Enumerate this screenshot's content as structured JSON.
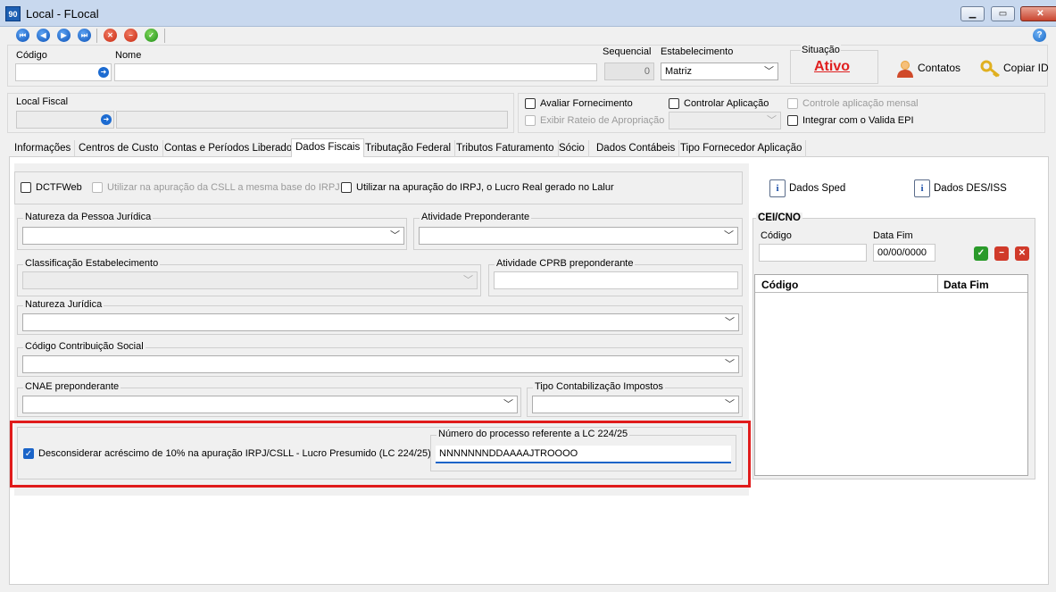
{
  "window": {
    "app_icon": "90",
    "title": "Local - FLocal",
    "minimize": "▁",
    "maximize": "▭",
    "close": "✕"
  },
  "toolbar": {
    "first": "⏮",
    "prev": "◀",
    "next": "▶",
    "last": "⏭",
    "cancel": "✕",
    "delete": "−",
    "confirm": "✓",
    "help": "?"
  },
  "header": {
    "codigo_label": "Código",
    "codigo_value": "",
    "nome_label": "Nome",
    "nome_value": "",
    "sequencial_label": "Sequencial",
    "sequencial_value": "0",
    "estabelecimento_label": "Estabelecimento",
    "estabelecimento_value": "Matriz",
    "situacao_label": "Situação",
    "situacao_value": "Ativo",
    "contatos_label": "Contatos",
    "copiar_id_label": "Copiar ID"
  },
  "fiscal": {
    "local_fiscal_label": "Local Fiscal",
    "local_fiscal_code": "",
    "local_fiscal_name": "",
    "avaliar_fornecimento": "Avaliar Fornecimento",
    "controlar_aplicacao": "Controlar Aplicação",
    "controle_aplicacao_mensal": "Controle aplicação mensal",
    "exibir_rateio": "Exibir Rateio de Apropriação",
    "integrar_valida_epi": "Integrar com o Valida EPI"
  },
  "tabs": [
    {
      "label": "Informações"
    },
    {
      "label": "Centros de Custo"
    },
    {
      "label": "Contas e Períodos Liberados"
    },
    {
      "label": "Dados Fiscais"
    },
    {
      "label": "Tributação Federal"
    },
    {
      "label": "Tributos Faturamento"
    },
    {
      "label": "Sócio"
    },
    {
      "label": "Dados Contábeis"
    },
    {
      "label": "Tipo Fornecedor Aplicação"
    }
  ],
  "dados_fiscais": {
    "dctfweb": "DCTFWeb",
    "utilizar_csll": "Utilizar na apuração da CSLL a mesma base do IRPJ",
    "utilizar_irpj": "Utilizar na apuração do IRPJ, o Lucro Real gerado no Lalur",
    "dados_sped": "Dados Sped",
    "dados_des_iss": "Dados DES/ISS",
    "natureza_pj_label": "Natureza da Pessoa Jurídica",
    "natureza_pj_value": "",
    "atividade_preponderante_label": "Atividade Preponderante",
    "atividade_preponderante_value": "",
    "classificacao_label": "Classificação Estabelecimento",
    "classificacao_value": "",
    "atividade_cprb_label": "Atividade CPRB preponderante",
    "atividade_cprb_value": "",
    "natureza_juridica_label": "Natureza Jurídica",
    "natureza_juridica_value": "",
    "codigo_contrib_label": "Código Contribuição Social",
    "codigo_contrib_value": "",
    "cnae_label": "CNAE preponderante",
    "cnae_value": "",
    "tipo_contab_label": "Tipo Contabilização Impostos",
    "tipo_contab_value": "",
    "desconsiderar_label": "Desconsiderar acréscimo de 10% na apuração IRPJ/CSLL - Lucro Presumido (LC 224/25)",
    "numero_processo_label": "Número do processo referente a LC 224/25",
    "numero_processo_value": "NNNNNNNDDAAAAJTROOOO"
  },
  "cei_cno": {
    "title": "CEI/CNO",
    "codigo_label": "Código",
    "codigo_value": "",
    "data_fim_label": "Data Fim",
    "data_fim_value": "00/00/0000",
    "grid_columns": [
      "Código",
      "Data Fim"
    ],
    "grid_rows": []
  },
  "colors": {
    "accent_blue": "#1a64c8",
    "situacao_red": "#e02020",
    "highlight_red": "#e01b1b"
  }
}
